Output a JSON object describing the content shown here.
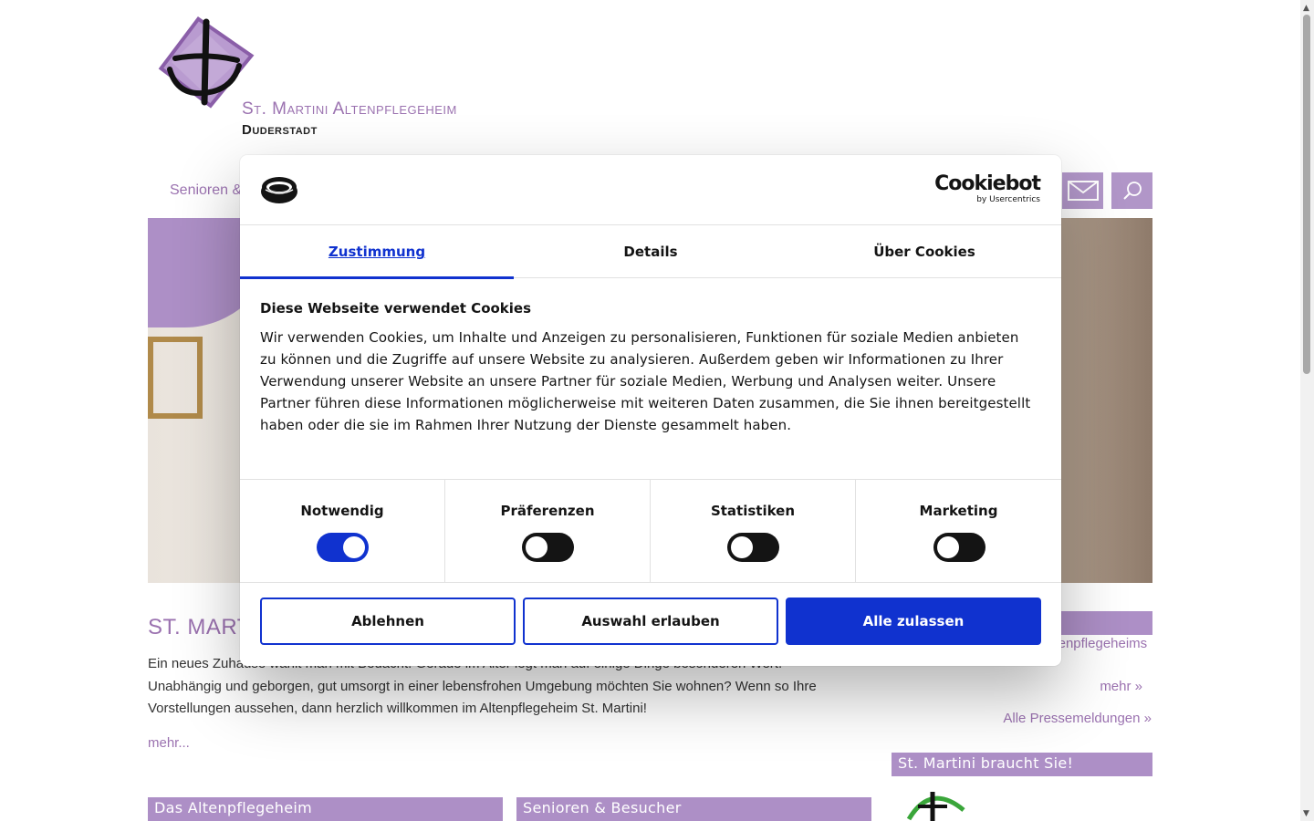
{
  "site": {
    "logo_title": "St. Martini Altenpflegeheim",
    "logo_subtitle": "Duderstadt",
    "nav_first_item": "Senioren &",
    "main_title": "ST. MART",
    "intro_text": "Ein neues Zuhause wählt man mit Bedacht. Gerade im Alter legt man auf einige Dinge besonderen Wert. Unabhängig und geborgen, gut umsorgt in einer lebensfrohen Umgebung möchten Sie wohnen? Wenn so Ihre Vorstellungen aussehen, dann herzlich willkommen im Altenpflegeheim St. Martini!",
    "more_link": "mehr...",
    "box_altenpflegeheim": "Das Altenpflegeheim",
    "box_senioren": "Senioren & Besucher",
    "press_link": "ergehege im Garten des Altenpflegeheims",
    "press_more": "mehr »",
    "press_all": "Alle Pressemeldungen »",
    "side_box_title": "St. Martini braucht Sie!",
    "accent_color": "#ad8fc6"
  },
  "cookie_dialog": {
    "brand_name": "Cookiebot",
    "brand_by": "by Usercentrics",
    "tabs": [
      {
        "label": "Zustimmung",
        "active": true
      },
      {
        "label": "Details",
        "active": false
      },
      {
        "label": "Über Cookies",
        "active": false
      }
    ],
    "title": "Diese Webseite verwendet Cookies",
    "text": "Wir verwenden Cookies, um Inhalte und Anzeigen zu personalisieren, Funktionen für soziale Medien anbieten zu können und die Zugriffe auf unsere Website zu analysieren. Außerdem geben wir Informationen zu Ihrer Verwendung unserer Website an unsere Partner für soziale Medien, Werbung und Analysen weiter. Unsere Partner führen diese Informationen möglicherweise mit weiteren Daten zusammen, die Sie ihnen bereitgestellt haben oder die sie im Rahmen Ihrer Nutzung der Dienste gesammelt haben.",
    "toggles": [
      {
        "label": "Notwendig",
        "on": true
      },
      {
        "label": "Präferenzen",
        "on": false
      },
      {
        "label": "Statistiken",
        "on": false
      },
      {
        "label": "Marketing",
        "on": false
      }
    ],
    "buttons": {
      "decline": "Ablehnen",
      "allow_selection": "Auswahl erlauben",
      "allow_all": "Alle zulassen"
    },
    "accent_color": "#1032cf"
  }
}
